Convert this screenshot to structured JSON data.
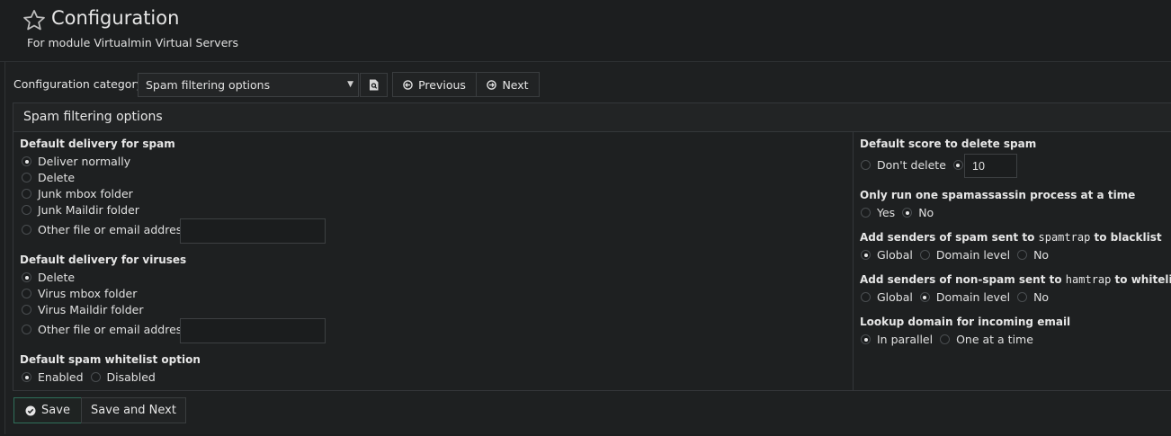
{
  "header": {
    "title": "Configuration",
    "subtitle": "For module Virtualmin Virtual Servers"
  },
  "toolbar": {
    "category_label": "Configuration category",
    "category_value": "Spam filtering options",
    "previous_label": "Previous",
    "next_label": "Next"
  },
  "panel": {
    "title": "Spam filtering options"
  },
  "left": {
    "spam_delivery": {
      "label": "Default delivery for spam",
      "options": [
        "Deliver normally",
        "Delete",
        "Junk mbox folder",
        "Junk Maildir folder",
        "Other file or email address"
      ],
      "selected": "Deliver normally",
      "other_value": ""
    },
    "virus_delivery": {
      "label": "Default delivery for viruses",
      "options": [
        "Delete",
        "Virus mbox folder",
        "Virus Maildir folder",
        "Other file or email address"
      ],
      "selected": "Delete",
      "other_value": ""
    },
    "whitelist": {
      "label": "Default spam whitelist option",
      "options": [
        "Enabled",
        "Disabled"
      ],
      "selected": "Enabled"
    }
  },
  "right": {
    "delete_score": {
      "label": "Default score to delete spam",
      "options": [
        "Don't delete",
        ""
      ],
      "selected_index": 1,
      "value": "10"
    },
    "one_process": {
      "label": "Only run one spamassassin process at a time",
      "options": [
        "Yes",
        "No"
      ],
      "selected": "No"
    },
    "spamtrap": {
      "label_pre": "Add senders of spam sent to ",
      "label_code": "spamtrap",
      "label_post": " to blacklist",
      "options": [
        "Global",
        "Domain level",
        "No"
      ],
      "selected": "Global"
    },
    "hamtrap": {
      "label_pre": "Add senders of non-spam sent to ",
      "label_code": "hamtrap",
      "label_post": " to whitelist",
      "options": [
        "Global",
        "Domain level",
        "No"
      ],
      "selected": "Domain level"
    },
    "lookup": {
      "label": "Lookup domain for incoming email",
      "options": [
        "In parallel",
        "One at a time"
      ],
      "selected": "In parallel"
    }
  },
  "footer": {
    "save_label": "Save",
    "save_next_label": "Save and Next"
  },
  "icons": {
    "favorite": "star-outline-icon",
    "view": "document-search-icon",
    "previous": "arrow-circle-left-icon",
    "next": "arrow-circle-right-icon",
    "save": "check-circle-icon"
  },
  "colors": {
    "background": "#1c1e1f",
    "save_border": "#2f6f5a"
  }
}
